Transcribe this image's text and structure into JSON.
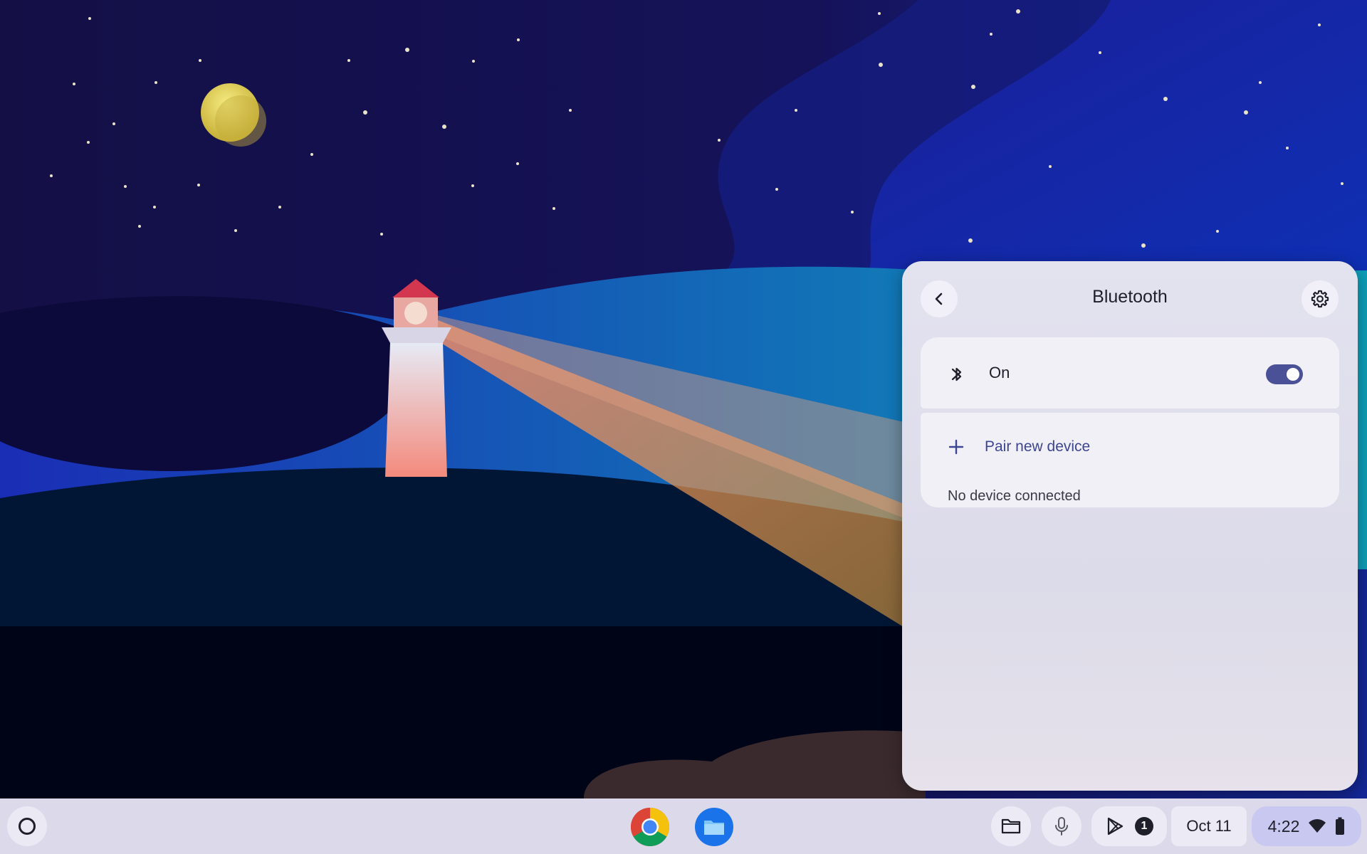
{
  "bluetooth_panel": {
    "title": "Bluetooth",
    "back_icon": "chevron-left-icon",
    "settings_icon": "gear-icon",
    "bluetooth_icon": "bluetooth-icon",
    "state_label": "On",
    "toggle_on": true,
    "pair_new_device_label": "Pair new device",
    "pair_icon": "plus-icon",
    "no_device_text": "No device connected"
  },
  "shelf": {
    "launcher_icon": "launcher-circle-icon",
    "pinned_apps": [
      {
        "name": "chrome",
        "icon": "chrome-icon"
      },
      {
        "name": "files",
        "icon": "files-icon"
      }
    ],
    "tray": {
      "holding_space_icon": "folder-icon",
      "mic_icon": "microphone-icon",
      "cast_icon": "play-store-icon",
      "notification_count": "1",
      "date": "Oct 11",
      "time": "4:22",
      "wifi_icon": "wifi-icon",
      "battery_icon": "battery-icon"
    }
  },
  "colors": {
    "accent": "#4b5196",
    "link": "#3d4590",
    "panel_bg": "#e3e2ef",
    "shelf_bg": "#dcdaea",
    "status_pill": "#c9c8f0"
  }
}
